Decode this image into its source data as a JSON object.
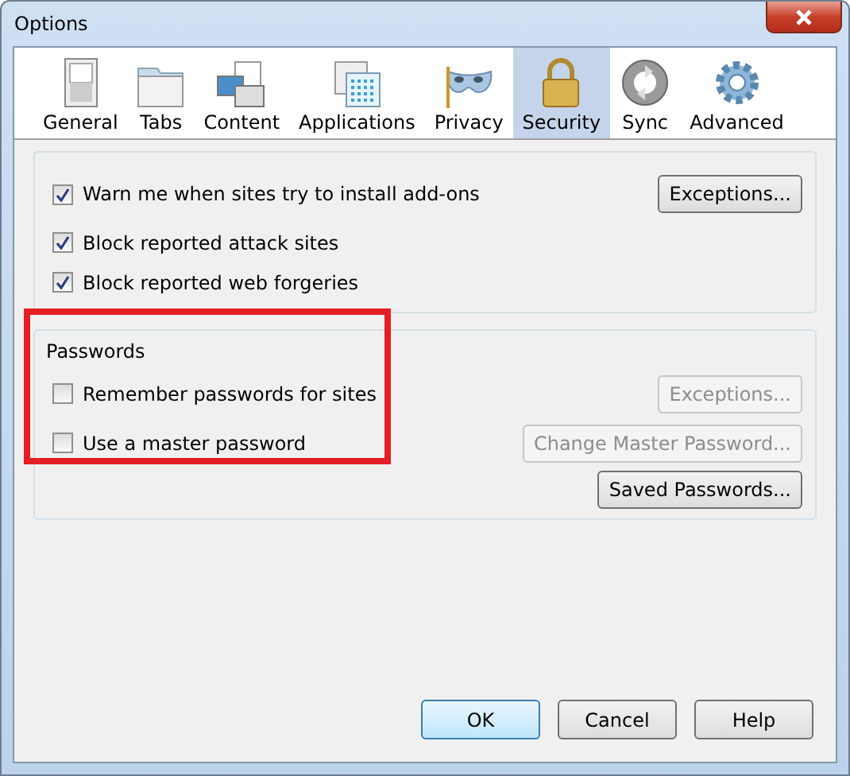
{
  "window": {
    "title": "Options"
  },
  "tabs": [
    {
      "label": "General",
      "kind": "switch",
      "selected": false
    },
    {
      "label": "Tabs",
      "kind": "folder",
      "selected": false
    },
    {
      "label": "Content",
      "kind": "content",
      "selected": false
    },
    {
      "label": "Applications",
      "kind": "apps",
      "selected": false
    },
    {
      "label": "Privacy",
      "kind": "mask",
      "selected": false
    },
    {
      "label": "Security",
      "kind": "lock",
      "selected": true
    },
    {
      "label": "Sync",
      "kind": "sync",
      "selected": false
    },
    {
      "label": "Advanced",
      "kind": "gear",
      "selected": false
    }
  ],
  "general_group": {
    "options": [
      {
        "label": "Warn me when sites try to install add-ons",
        "checked": true,
        "button": {
          "label": "Exceptions...",
          "disabled": false
        }
      },
      {
        "label": "Block reported attack sites",
        "checked": true
      },
      {
        "label": "Block reported web forgeries",
        "checked": true
      }
    ]
  },
  "passwords_group": {
    "title": "Passwords",
    "options": [
      {
        "label": "Remember passwords for sites",
        "checked": false,
        "button": {
          "label": "Exceptions...",
          "disabled": true
        }
      },
      {
        "label": "Use a master password",
        "checked": false,
        "button": {
          "label": "Change Master Password...",
          "disabled": true
        }
      }
    ],
    "button": {
      "label": "Saved Passwords...",
      "disabled": false
    }
  },
  "buttons": [
    {
      "label": "OK",
      "selected": true
    },
    {
      "label": "Cancel",
      "selected": false
    },
    {
      "label": "Help",
      "selected": false
    }
  ]
}
